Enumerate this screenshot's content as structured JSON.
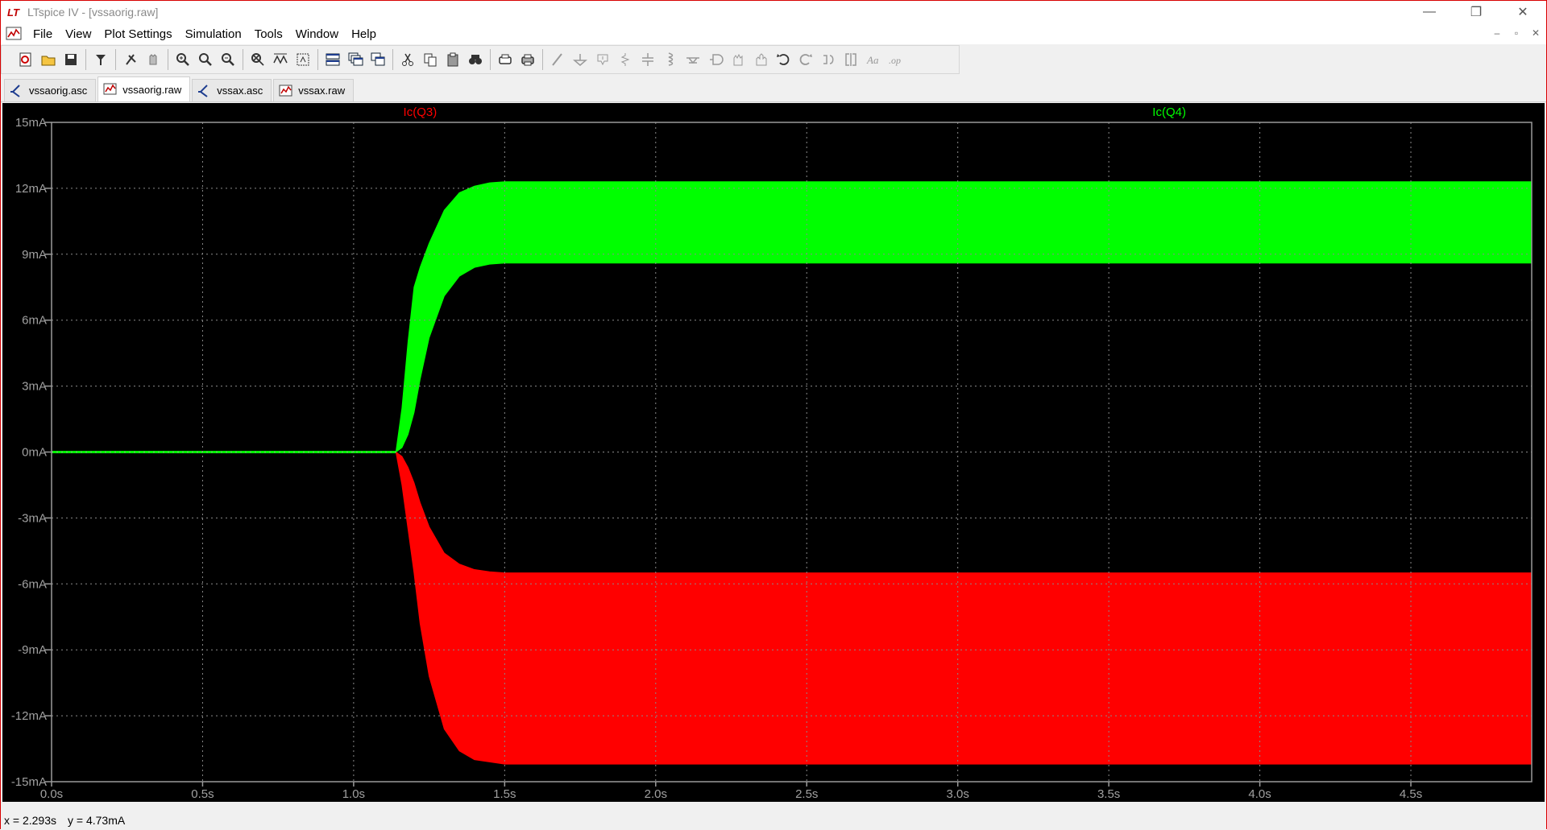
{
  "window": {
    "title": "LTspice IV - [vssaorig.raw]",
    "controls": {
      "minimize": "—",
      "restore": "❐",
      "close": "✕"
    }
  },
  "menu": {
    "items": [
      {
        "name": "file",
        "label": "File"
      },
      {
        "name": "view",
        "label": "View"
      },
      {
        "name": "plot-settings",
        "label": "Plot Settings"
      },
      {
        "name": "simulation",
        "label": "Simulation"
      },
      {
        "name": "tools",
        "label": "Tools"
      },
      {
        "name": "window",
        "label": "Window"
      },
      {
        "name": "help",
        "label": "Help"
      }
    ],
    "mdi": {
      "minimize": "–",
      "restore": "▫",
      "close": "✕"
    }
  },
  "toolbar": {
    "icons": [
      "new-schematic-icon",
      "open-icon",
      "save-icon",
      "control-panel-icon",
      "run-icon",
      "halt-icon",
      "zoom-in-icon",
      "zoom-area-icon",
      "zoom-out-icon",
      "zoom-fit-icon",
      "autorange-icon",
      "zoom-extents-icon",
      "tile-horizontal-icon",
      "cascade-icon",
      "tile-vertical-icon",
      "cut-icon",
      "copy-icon",
      "paste-icon",
      "find-icon",
      "print-setup-icon",
      "print-icon",
      "wire-icon",
      "ground-icon",
      "label-icon",
      "resistor-icon",
      "capacitor-icon",
      "inductor-icon",
      "diode-icon",
      "component-icon",
      "move-icon",
      "drag-icon",
      "undo-icon",
      "redo-icon",
      "rotate-icon",
      "mirror-icon",
      "text-icon",
      "spice-directive-icon"
    ]
  },
  "tabs": [
    {
      "label": "vssaorig.asc",
      "kind": "schematic",
      "active": false
    },
    {
      "label": "vssaorig.raw",
      "kind": "waveform",
      "active": true
    },
    {
      "label": "vssax.asc",
      "kind": "schematic",
      "active": false
    },
    {
      "label": "vssax.raw",
      "kind": "waveform",
      "active": false
    }
  ],
  "statusbar": {
    "x_readout": "x = 2.293s",
    "y_readout": "y = 4.73mA"
  },
  "chart_data": {
    "type": "area",
    "background": "#000000",
    "grid": true,
    "xlim": [
      0,
      4.9
    ],
    "ylim": [
      -15,
      15
    ],
    "x_ticks": [
      0,
      0.5,
      1.0,
      1.5,
      2.0,
      2.5,
      3.0,
      3.5,
      4.0,
      4.5
    ],
    "x_tick_labels": [
      "0.0s",
      "0.5s",
      "1.0s",
      "1.5s",
      "2.0s",
      "2.5s",
      "3.0s",
      "3.5s",
      "4.0s",
      "4.5s"
    ],
    "y_ticks": [
      15,
      12,
      9,
      6,
      3,
      0,
      -3,
      -6,
      -9,
      -12,
      -15
    ],
    "y_tick_labels": [
      "15mA",
      "12mA",
      "9mA",
      "6mA",
      "3mA",
      "0mA",
      "-3mA",
      "-6mA",
      "-9mA",
      "-12mA",
      "-15mA"
    ],
    "series": [
      {
        "name": "Ic(Q3)",
        "color": "#ff0000",
        "x": [
          0,
          1.14,
          1.16,
          1.18,
          1.2,
          1.22,
          1.25,
          1.3,
          1.35,
          1.4,
          1.45,
          1.5,
          1.6,
          4.9
        ],
        "upper": [
          0,
          0,
          -0.2,
          -0.7,
          -1.4,
          -2.3,
          -3.4,
          -4.6,
          -5.1,
          -5.35,
          -5.45,
          -5.5,
          -5.5,
          -5.5
        ],
        "lower": [
          0,
          0,
          -1.5,
          -3.5,
          -5.5,
          -7.8,
          -10.2,
          -12.6,
          -13.6,
          -14.0,
          -14.1,
          -14.2,
          -14.2,
          -14.2
        ]
      },
      {
        "name": "Ic(Q4)",
        "color": "#00ff00",
        "x": [
          0,
          1.14,
          1.16,
          1.18,
          1.2,
          1.22,
          1.25,
          1.3,
          1.35,
          1.4,
          1.45,
          1.5,
          1.6,
          4.9
        ],
        "upper": [
          0,
          0,
          2.0,
          5.0,
          7.5,
          8.4,
          9.5,
          11.0,
          11.8,
          12.1,
          12.25,
          12.3,
          12.3,
          12.3
        ],
        "lower": [
          0,
          0,
          0.2,
          0.8,
          1.8,
          3.3,
          5.2,
          7.1,
          8.0,
          8.4,
          8.55,
          8.6,
          8.6,
          8.6
        ]
      }
    ]
  }
}
